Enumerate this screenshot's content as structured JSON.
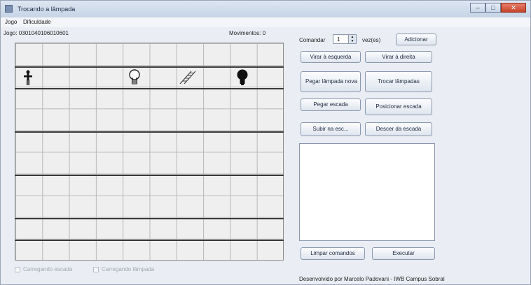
{
  "window": {
    "title": "Trocando a lâmpada"
  },
  "menu": [
    "Jogo",
    "Dificuldade"
  ],
  "game": {
    "sequence_label": "Jogo: 0301040106010601",
    "moves_label": "Movimentos: 0"
  },
  "board": {
    "rows": 10,
    "cols": 10,
    "pieces": [
      {
        "name": "person-icon",
        "row": 1,
        "col": 0
      },
      {
        "name": "new-lamp-icon",
        "row": 1,
        "col": 4
      },
      {
        "name": "ladder-icon",
        "row": 1,
        "col": 6
      },
      {
        "name": "burnt-lamp-icon",
        "row": 1,
        "col": 8
      }
    ]
  },
  "controls": {
    "commands_label": "Comandar",
    "repeat_value": "1",
    "times_label": "vez(es)",
    "add_button": "Adicionar",
    "turn_left": "Virar à esquerda",
    "turn_right": "Virar à direita",
    "pick_new_lamp": "Pegar lâmpada nova",
    "swap_lamps": "Trocar lâmpadas",
    "pick_ladder": "Pegar escada",
    "place_ladder": "Posicionar escada",
    "climb_ladder": "Subir na esc...",
    "descend_ladder": "Descer da escada",
    "clear_commands": "Limpar comandos",
    "execute": "Executar"
  },
  "status": {
    "carrying_ladder": "Carregando escada",
    "carrying_lamp": "Carregando lâmpada"
  },
  "footer": "Desenvolvido por Marcelo Padovani - IWB Campus Sobral"
}
